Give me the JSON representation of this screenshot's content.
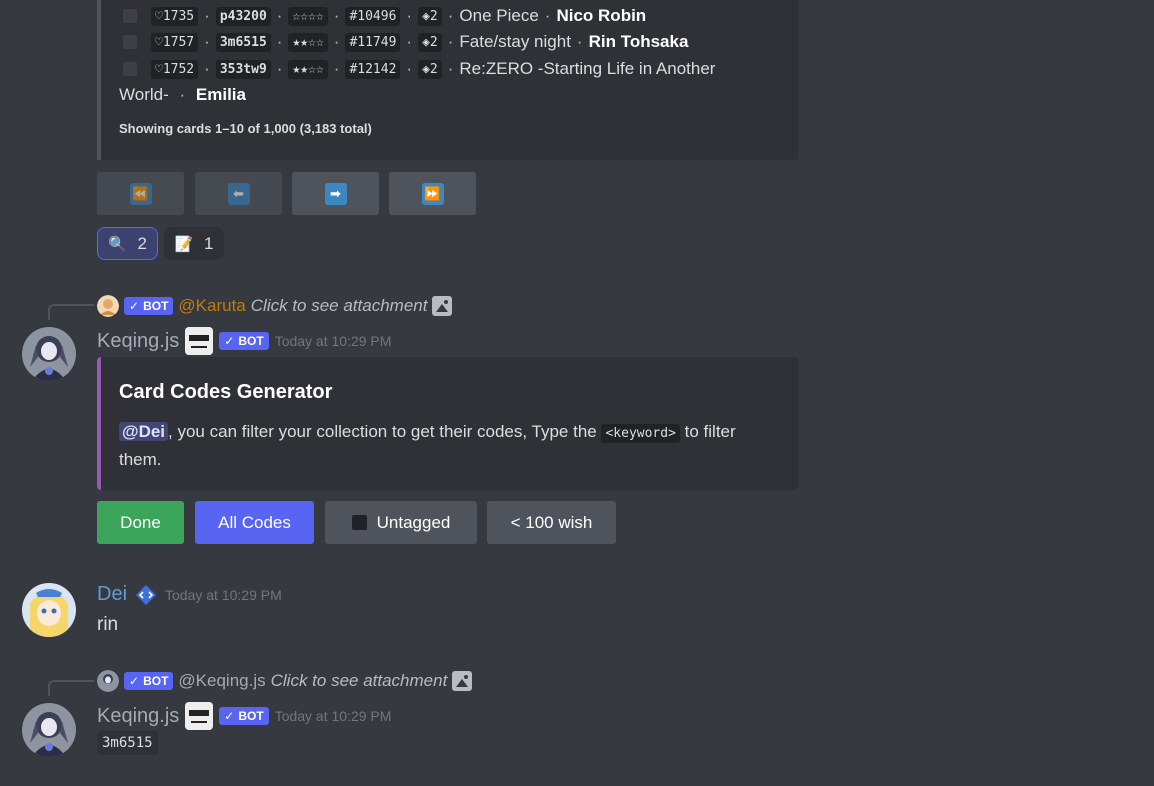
{
  "colors": {
    "background": "#36393f",
    "embed_bg": "#2f3136",
    "embed_accent": "#9b59b6",
    "blurple": "#5865f2",
    "green": "#3ba55c",
    "grey_button": "#4f545c",
    "karuta_name": "#c27c0e",
    "dei_name": "#5c9dd6"
  },
  "card_list": {
    "rows": [
      {
        "hearts": "♡1735",
        "code": "p43200",
        "stars": "☆☆☆☆",
        "number": "#10496",
        "edition": "◈2",
        "series": "One Piece",
        "character": "Nico Robin"
      },
      {
        "hearts": "♡1757",
        "code": "3m6515",
        "stars": "★★☆☆",
        "number": "#11749",
        "edition": "◈2",
        "series": "Fate/stay night",
        "character": "Rin Tohsaka"
      },
      {
        "hearts": "♡1752",
        "code": "353tw9",
        "stars": "★★☆☆",
        "number": "#12142",
        "edition": "◈2",
        "series": "Re:ZERO -Starting Life in Another",
        "character": "Emilia"
      }
    ],
    "wrap_text": "World-",
    "footer": "Showing cards 1–10 of 1,000 (3,183 total)"
  },
  "pagination": {
    "first_icon": "first-page-icon",
    "prev_icon": "previous-page-icon",
    "next_icon": "next-page-icon",
    "last_icon": "last-page-icon",
    "glyph_first": "⏪",
    "glyph_prev": "⬅",
    "glyph_next": "➡",
    "glyph_last": "⏩"
  },
  "reactions": [
    {
      "emoji": "🔍",
      "count": "2",
      "icon": "magnifier-icon"
    },
    {
      "emoji": "📝",
      "count": "1",
      "icon": "memo-icon"
    }
  ],
  "message1": {
    "reply": {
      "bot_label": "BOT",
      "name": "@Karuta",
      "text": "Click to see attachment"
    },
    "author": "Keqing.js",
    "bot_label": "BOT",
    "timestamp": "Today at 10:29 PM",
    "embed": {
      "title": "Card Codes Generator",
      "mention": "@Dei",
      "desc_before": ", you can filter your collection to get their codes, Type the ",
      "keyword": "<keyword>",
      "desc_after": " to filter them."
    },
    "buttons": {
      "done": "Done",
      "all_codes": "All Codes",
      "untagged": "Untagged",
      "wish": "< 100 wish"
    }
  },
  "message2": {
    "author": "Dei",
    "timestamp": "Today at 10:29 PM",
    "text": "rin"
  },
  "message3": {
    "reply": {
      "bot_label": "BOT",
      "name": "@Keqing.js",
      "text": "Click to see attachment"
    },
    "author": "Keqing.js",
    "bot_label": "BOT",
    "timestamp": "Today at 10:29 PM",
    "code": "3m6515"
  }
}
